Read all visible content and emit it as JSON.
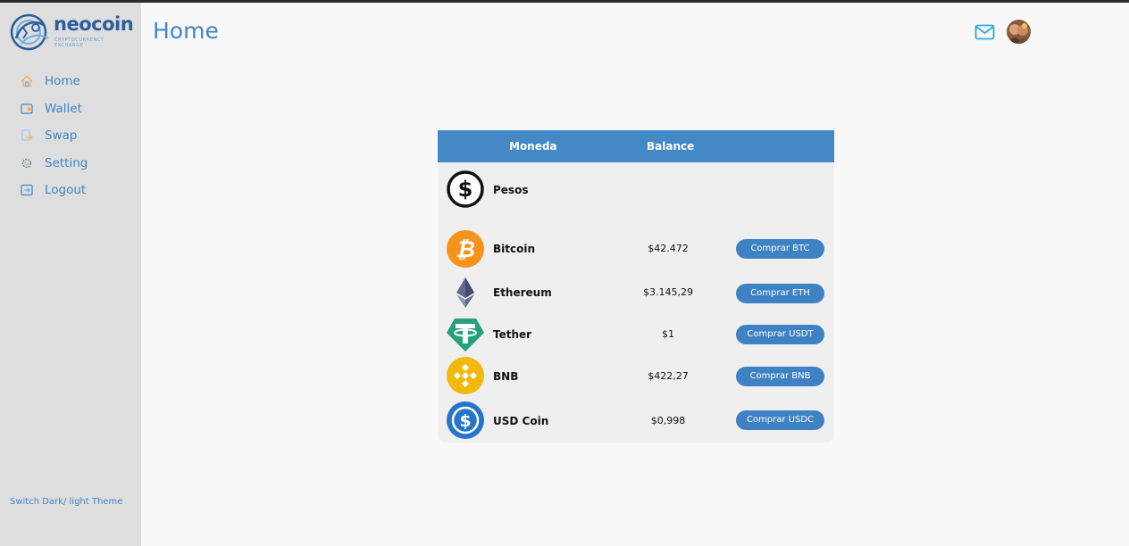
{
  "brand": {
    "name": "neocoin",
    "tagline": "CRYPTOCURRENCY EXCHANGE"
  },
  "sidebar": {
    "items": [
      {
        "label": "Home",
        "icon": "home-icon"
      },
      {
        "label": "Wallet",
        "icon": "wallet-icon"
      },
      {
        "label": "Swap",
        "icon": "swap-icon"
      },
      {
        "label": "Setting",
        "icon": "gear-icon"
      },
      {
        "label": "Logout",
        "icon": "logout-icon"
      }
    ],
    "theme_switch": "Switch Dark/ light Theme"
  },
  "header": {
    "title": "Home"
  },
  "table": {
    "headers": {
      "coin": "Moneda",
      "balance": "Balance"
    },
    "rows": [
      {
        "name": "Pesos",
        "price": "",
        "button": "",
        "icon": "pesos-icon"
      },
      {
        "name": "Bitcoin",
        "price": "$42.472",
        "button": "Comprar BTC",
        "icon": "bitcoin-icon"
      },
      {
        "name": "Ethereum",
        "price": "$3.145,29",
        "button": "Comprar ETH",
        "icon": "ethereum-icon"
      },
      {
        "name": "Tether",
        "price": "$1",
        "button": "Comprar USDT",
        "icon": "tether-icon"
      },
      {
        "name": "BNB",
        "price": "$422,27",
        "button": "Comprar BNB",
        "icon": "bnb-icon"
      },
      {
        "name": "USD Coin",
        "price": "$0,998",
        "button": "Comprar USDC",
        "icon": "usdc-icon"
      }
    ]
  },
  "colors": {
    "accent": "#3f86c4",
    "table_header": "#4588c6",
    "button": "#3f82c3",
    "sidebar_bg": "#dedede"
  }
}
